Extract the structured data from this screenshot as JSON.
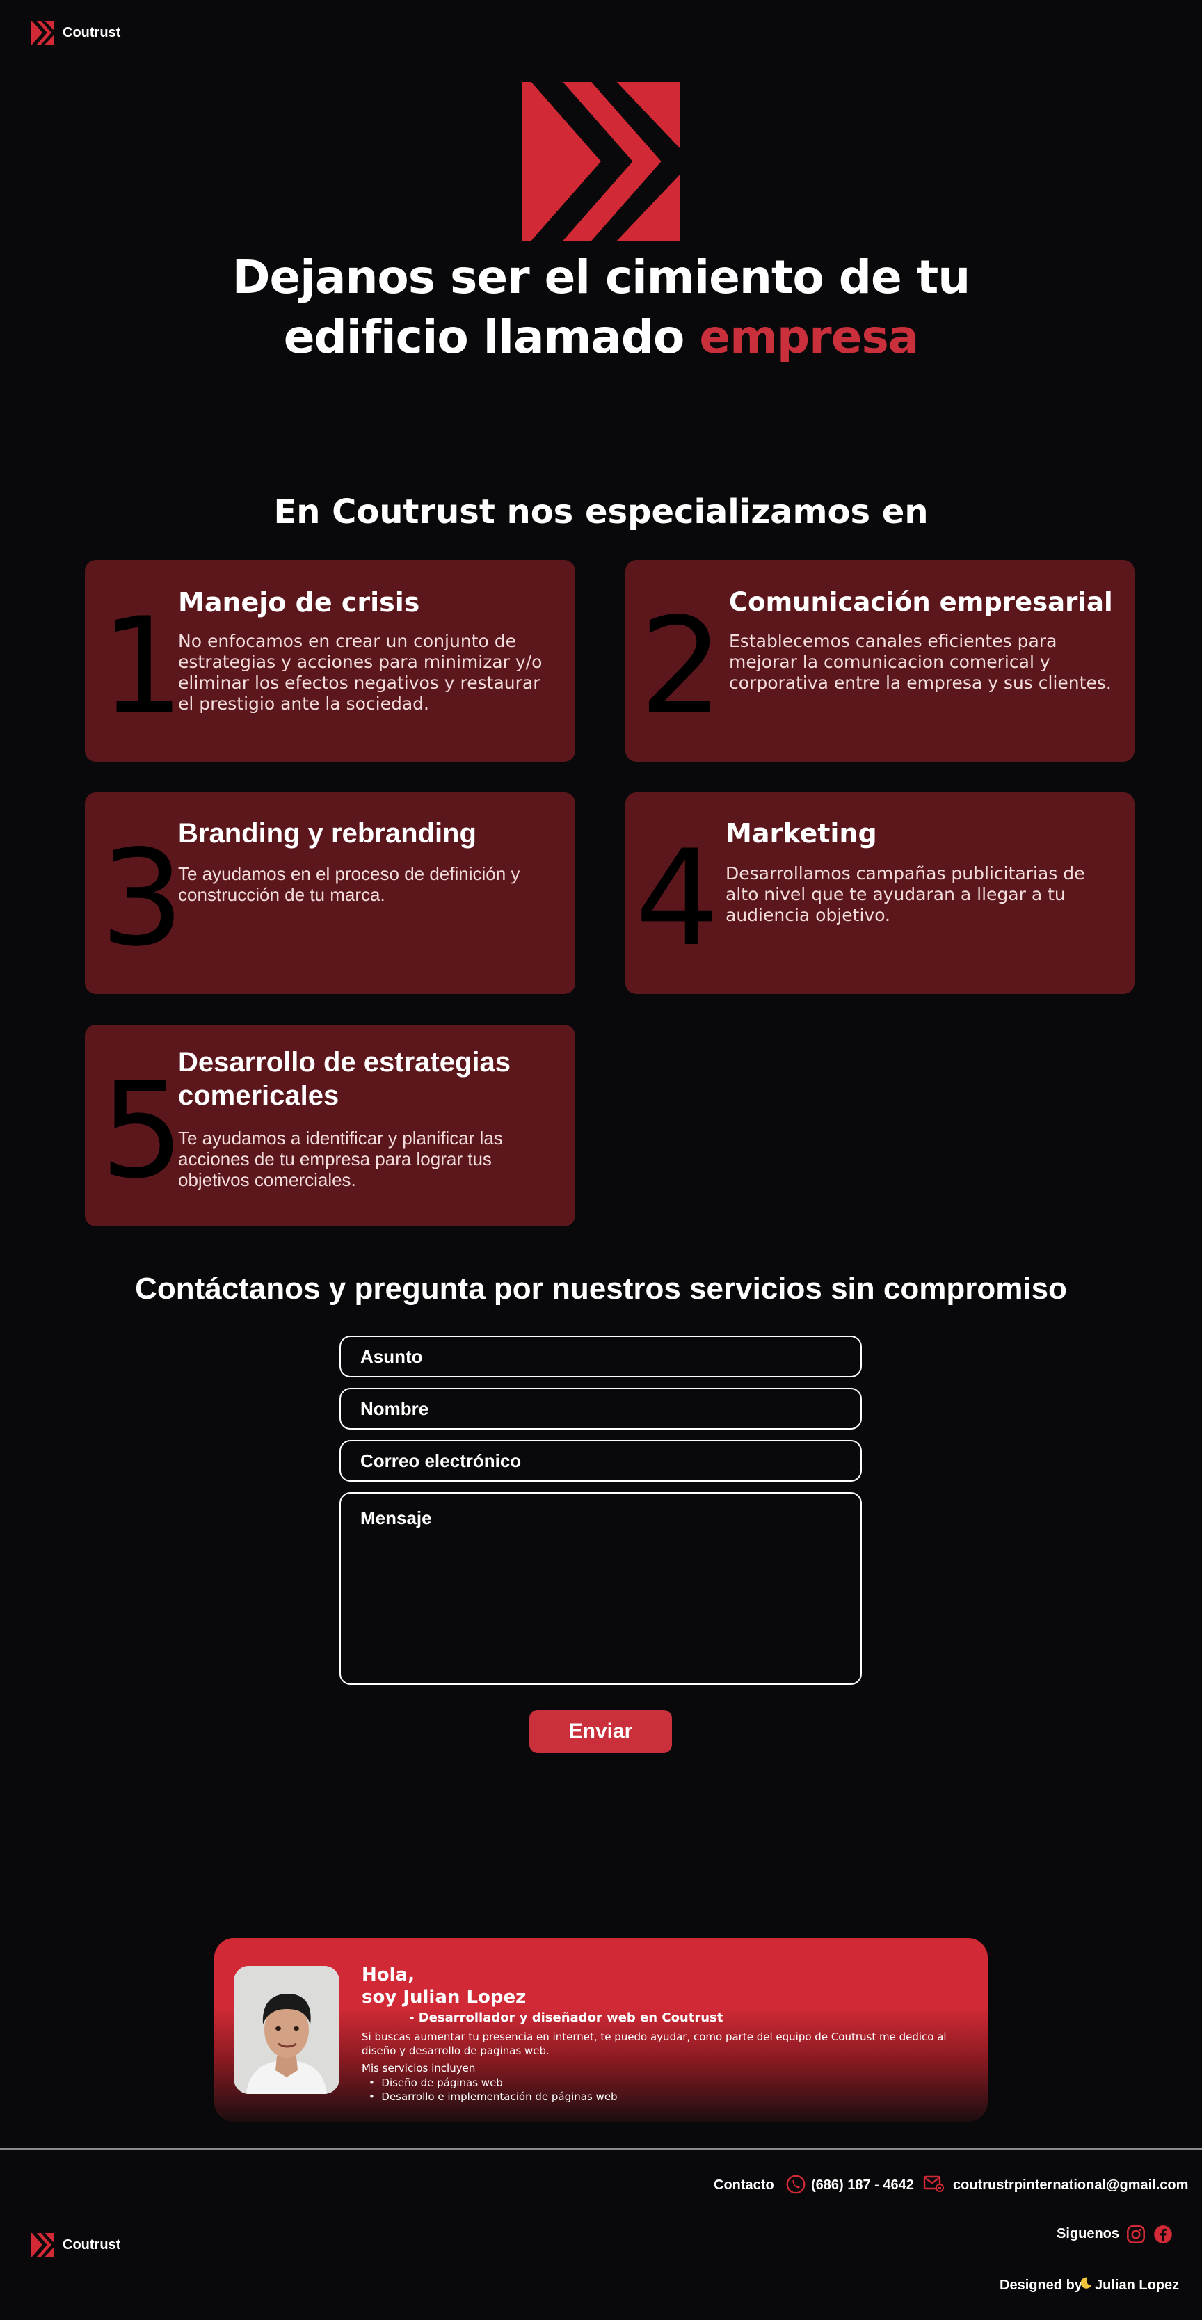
{
  "brand": {
    "name": "Coutrust",
    "accent": "#c9303b",
    "card_bg": "#5c171d"
  },
  "hero": {
    "title_line1": "Dejanos ser el cimiento de tu",
    "title_line2_prefix": "edificio llamado",
    "title_accent": "empresa"
  },
  "services": {
    "heading": "En Coutrust nos especializamos en",
    "items": [
      {
        "number": "1",
        "title": "Manejo de crisis",
        "desc": "No enfocamos en crear un conjunto de estrategias y acciones para minimizar y/o eliminar los efectos negativos y restaurar el prestigio ante la sociedad."
      },
      {
        "number": "2",
        "title": "Comunicación empresarial",
        "desc": "Establecemos canales  eficientes para mejorar la comunicacion comerical y corporativa entre la empresa y sus clientes."
      },
      {
        "number": "3",
        "title": "Branding y rebranding",
        "desc": "Te ayudamos en el proceso de definición y construcción de tu marca."
      },
      {
        "number": "4",
        "title": "Marketing",
        "desc": "Desarrollamos campañas publicitarias de alto nivel que te ayudaran a llegar a tu audiencia objetivo."
      },
      {
        "number": "5",
        "title": "Desarrollo de estrategias comericales",
        "desc": "Te ayudamos a identificar y planificar las acciones de tu empresa para lograr tus objetivos comerciales."
      }
    ]
  },
  "contact_form": {
    "heading": "Contáctanos y pregunta por nuestros servicios sin compromiso",
    "subject_placeholder": "Asunto",
    "name_placeholder": "Nombre",
    "email_placeholder": "Correo electrónico",
    "message_placeholder": "Mensaje",
    "submit_label": "Enviar"
  },
  "profile": {
    "greeting": "Hola,",
    "name_line": "soy Julian Lopez",
    "role": "- Desarrollador y diseñador web en Coutrust",
    "bio": "Si buscas aumentar tu presencia en internet, te puedo ayudar, como parte del equipo de Coutrust me dedico al diseño y desarrollo de paginas web.",
    "services_label": "Mis servicios incluyen",
    "services": [
      "Diseño de páginas web",
      "Desarrollo e implementación de páginas web"
    ]
  },
  "footer": {
    "contact_label": "Contacto",
    "phone": "(686) 187 - 4642",
    "email": "coutrustrpinternational@gmail.com",
    "follow_label": "Siguenos",
    "designed_by_prefix": "Designed by",
    "designer": "Julian Lopez",
    "icons": [
      "phone-icon",
      "email-icon",
      "instagram-icon",
      "facebook-icon",
      "moon-icon"
    ]
  }
}
